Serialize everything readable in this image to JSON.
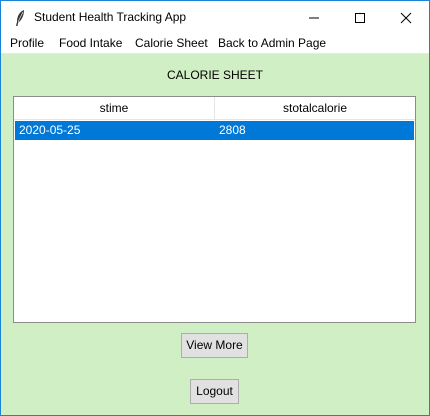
{
  "window": {
    "title": "Student Health Tracking App",
    "icon": "feather-icon",
    "controls": [
      "minimize-icon",
      "maximize-icon",
      "close-icon"
    ]
  },
  "menu": {
    "items": [
      {
        "label": "Profile"
      },
      {
        "label": "Food Intake"
      },
      {
        "label": "Calorie Sheet"
      },
      {
        "label": "Back to Admin Page"
      }
    ]
  },
  "main": {
    "heading": "CALORIE SHEET",
    "table": {
      "columns": [
        "stime",
        "stotalcalorie"
      ],
      "rows": [
        {
          "stime": "2020-05-25",
          "stotalcalorie": "2808",
          "selected": true
        }
      ]
    },
    "view_more_label": "View More",
    "logout_label": "Logout"
  },
  "colors": {
    "background": "#d1efc4",
    "selection": "#0078d7",
    "window_border": "#1883d7"
  }
}
